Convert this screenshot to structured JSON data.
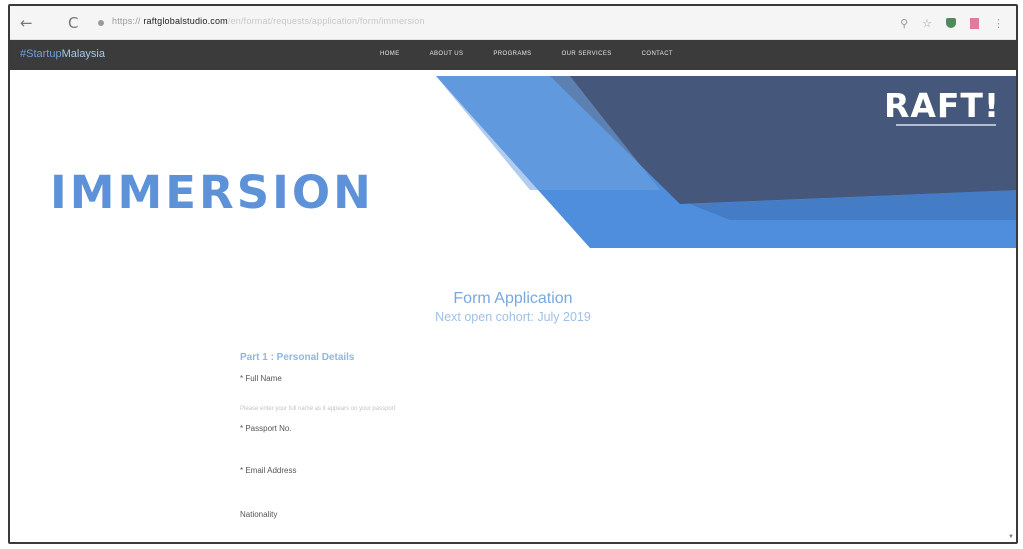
{
  "browser": {
    "back_icon": "back-arrow-icon",
    "back_glyph": "←",
    "reload_icon": "reload-icon",
    "reload_glyph": "C",
    "url_prefix": "https://",
    "url_host": "raftglobalstudio.com",
    "url_path": "/en/format/requests/application/form/immersion",
    "extension_icons": [
      "search-icon",
      "star-icon",
      "shield-icon",
      "bookmark-icon",
      "menu-icon"
    ],
    "search_glyph": "⚲",
    "star_glyph": "☆",
    "menu_glyph": "⋮"
  },
  "site_nav": {
    "brand_prefix": "#Startup",
    "brand_rest": "Malaysia",
    "links": [
      "Home",
      "About Us",
      "Programs",
      "Our Services",
      "Contact"
    ]
  },
  "hero": {
    "title": "IMMERSION",
    "logo": "RAFT!",
    "colors": {
      "blue": "#4f8edc",
      "navy": "#45577a",
      "light_blue": "#6fa3e0",
      "title_blue": "#5d92d8"
    }
  },
  "form": {
    "title": "Form Application",
    "subtitle": "Next open cohort: July 2019",
    "section_heading": "Part 1 : Personal Details",
    "fields": {
      "full_name": "* Full Name",
      "full_name_hint": "Please enter your full name as it appears on your passport",
      "passport_no": "* Passport No.",
      "email": "* Email Address",
      "nationality": "Nationality"
    }
  }
}
